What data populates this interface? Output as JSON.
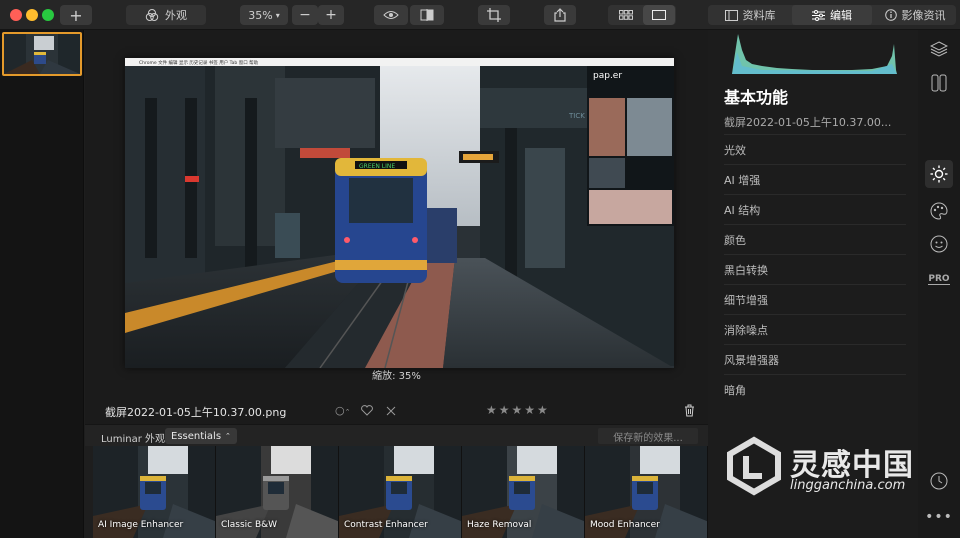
{
  "toolbar": {
    "add_label": "+",
    "looks_tab_label": "外观",
    "zoom_value": "35%",
    "zoom_minus": "−",
    "zoom_plus": "+",
    "library_tab": "资料库",
    "edit_tab": "编辑",
    "info_tab": "影像资讯"
  },
  "photo": {
    "app_menu": "Chrome  文件  编辑  显示  历史记录  书签  用户  Tab  窗口  帮助",
    "overlay_brand": "pap.er",
    "train_sign": "GREEN LINE",
    "station_sign": "TICK"
  },
  "canvas": {
    "zoom_label": "縮放: 35%"
  },
  "info": {
    "filename": "截屏2022-01-05上午10.37.00.png",
    "stars": "★★★★★"
  },
  "looks": {
    "label": "Luminar 外观:",
    "category": "Essentials",
    "save_label": "保存新的效果...",
    "items": [
      "AI Image Enhancer",
      "Classic B&W",
      "Contrast Enhancer",
      "Haze Removal",
      "Mood Enhancer"
    ]
  },
  "panel": {
    "title": "基本功能",
    "subtitle": "截屏2022-01-05上午10.37.00...",
    "tools": [
      "光效",
      "AI 增强",
      "AI 结构",
      "颜色",
      "黑白转换",
      "细节增强",
      "消除噪点",
      "风景增强器",
      "暗角"
    ]
  },
  "iconbar": {
    "pro_label": "PRO"
  },
  "watermark": {
    "title": "灵感中国",
    "url": "lingganchina.com"
  },
  "colors": {
    "accent": "#e49a2b",
    "histogram": "#7fe0c4"
  }
}
